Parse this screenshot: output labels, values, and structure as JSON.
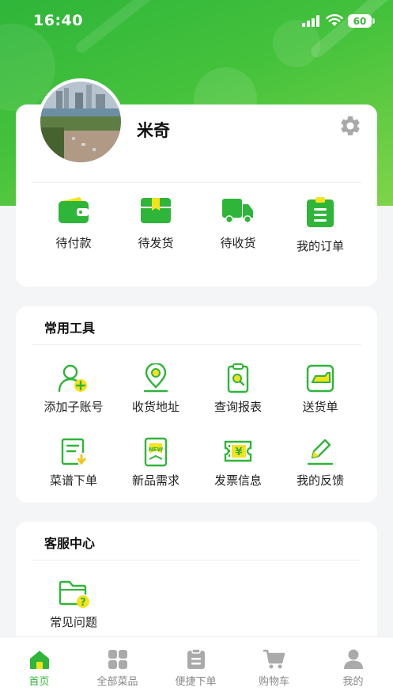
{
  "status_bar": {
    "time": "16:40",
    "battery": "60"
  },
  "profile": {
    "name": "米奇"
  },
  "orders": [
    {
      "label": "待付款",
      "icon": "wallet-icon"
    },
    {
      "label": "待发货",
      "icon": "box-icon"
    },
    {
      "label": "待收货",
      "icon": "truck-icon"
    },
    {
      "label": "我的订单",
      "icon": "clipboard-list-icon"
    }
  ],
  "tools": {
    "title": "常用工具",
    "items": [
      {
        "label": "添加子账号",
        "icon": "add-user-icon"
      },
      {
        "label": "收货地址",
        "icon": "location-pin-icon"
      },
      {
        "label": "查询报表",
        "icon": "report-search-icon"
      },
      {
        "label": "送货单",
        "icon": "delivery-note-icon"
      },
      {
        "label": "菜谱下单",
        "icon": "recipe-order-icon"
      },
      {
        "label": "新品需求",
        "icon": "new-product-icon"
      },
      {
        "label": "发票信息",
        "icon": "invoice-icon"
      },
      {
        "label": "我的反馈",
        "icon": "feedback-pen-icon"
      }
    ]
  },
  "service": {
    "title": "客服中心",
    "items": [
      {
        "label": "常见问题",
        "icon": "faq-folder-icon"
      }
    ]
  },
  "tabbar": [
    {
      "label": "首页",
      "icon": "home-icon",
      "active": true
    },
    {
      "label": "全部菜品",
      "icon": "grid-icon",
      "active": false
    },
    {
      "label": "便捷下单",
      "icon": "quick-order-icon",
      "active": false
    },
    {
      "label": "购物车",
      "icon": "cart-icon",
      "active": false
    },
    {
      "label": "我的",
      "icon": "user-icon",
      "active": false
    }
  ],
  "colors": {
    "primary": "#2fb53a",
    "accent_yellow": "#f6e21c",
    "tab_inactive": "#888888"
  }
}
